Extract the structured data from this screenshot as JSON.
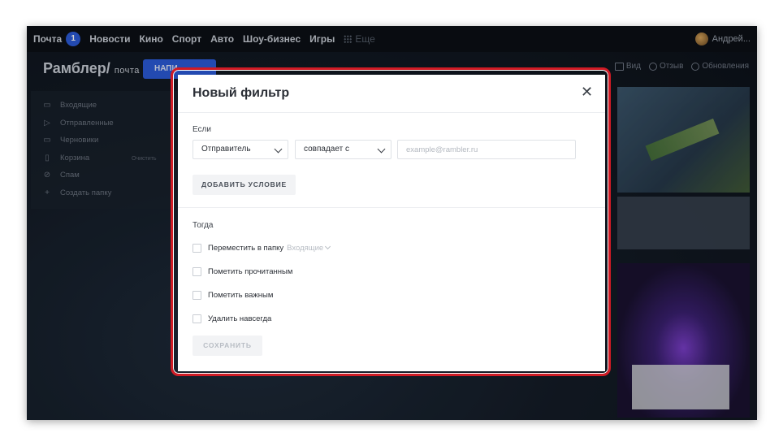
{
  "topbar": {
    "items": [
      "Почта",
      "Новости",
      "Кино",
      "Спорт",
      "Авто",
      "Шоу-бизнес",
      "Игры"
    ],
    "mail_badge": "1",
    "more_label": "Еще",
    "user_name": "Андрей..."
  },
  "header": {
    "logo": "Рамблер/",
    "logo_sub": "почта",
    "write_button": "НАПИ",
    "tools": [
      "Вид",
      "Отзыв",
      "Обновления"
    ]
  },
  "sidebar": {
    "items": [
      {
        "label": "Входящие",
        "icon": "inbox-icon"
      },
      {
        "label": "Отправленные",
        "icon": "send-icon"
      },
      {
        "label": "Черновики",
        "icon": "draft-icon"
      },
      {
        "label": "Корзина",
        "icon": "trash-icon"
      },
      {
        "label": "Спам",
        "icon": "spam-icon"
      },
      {
        "label": "Создать папку",
        "icon": "plus-icon"
      }
    ],
    "clear_label": "Очистить"
  },
  "modal": {
    "title": "Новый фильтр",
    "if_label": "Если",
    "field_select": "Отправитель",
    "condition_select": "совпадает с",
    "value_placeholder": "example@rambler.ru",
    "add_condition": "ДОБАВИТЬ УСЛОВИЕ",
    "then_label": "Тогда",
    "actions": [
      {
        "label": "Переместить в папку",
        "checked": false
      },
      {
        "label": "Пометить прочитанным",
        "checked": false
      },
      {
        "label": "Пометить важным",
        "checked": false
      },
      {
        "label": "Удалить навсегда",
        "checked": false
      }
    ],
    "folder_select": "Входящие",
    "save_button": "СОХРАНИТЬ"
  },
  "colors": {
    "highlight": "#d01b25",
    "accent": "#2b5bd8"
  }
}
